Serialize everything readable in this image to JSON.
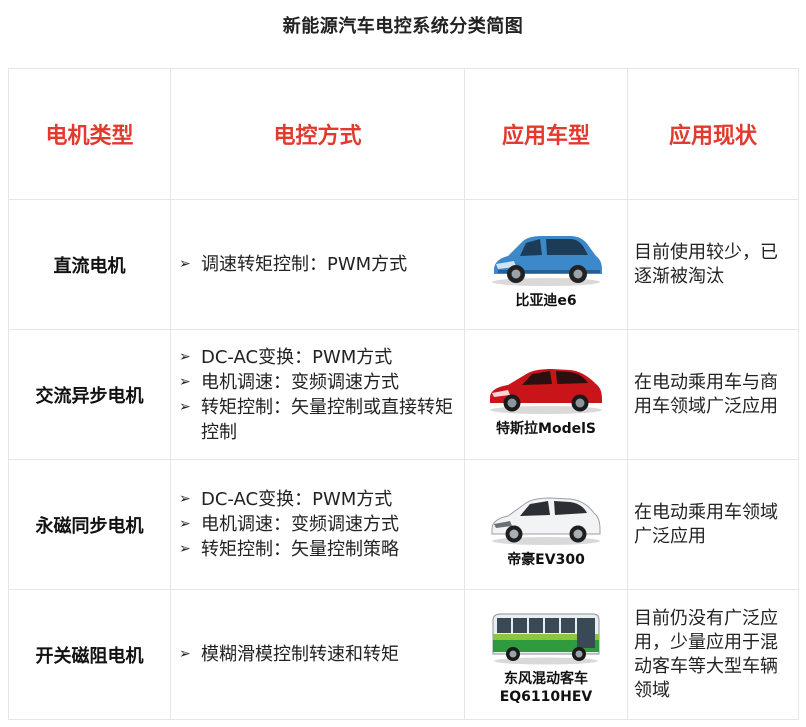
{
  "title": "新能源汽车电控系统分类简图",
  "headers": [
    "电机类型",
    "电控方式",
    "应用车型",
    "应用现状"
  ],
  "colors": {
    "header_red": "#e13a2e"
  },
  "rows": [
    {
      "motor": "直流电机",
      "methods": [
        "调速转矩控制：PWM方式"
      ],
      "vehicle": {
        "name_lines": [
          "比亚迪e6"
        ],
        "image": "blue-hatchback-car"
      },
      "status": "目前使用较少，已逐渐被淘汰"
    },
    {
      "motor": "交流异步电机",
      "methods": [
        "DC-AC变换：PWM方式",
        "电机调速：变频调速方式",
        "转矩控制：矢量控制或直接转矩控制"
      ],
      "vehicle": {
        "name_lines": [
          "特斯拉ModelS"
        ],
        "image": "red-sedan-car"
      },
      "status": "在电动乘用车与商用车领域广泛应用"
    },
    {
      "motor": "永磁同步电机",
      "methods": [
        "DC-AC变换：PWM方式",
        "电机调速：变频调速方式",
        "转矩控制：矢量控制策略"
      ],
      "vehicle": {
        "name_lines": [
          "帝豪EV300"
        ],
        "image": "white-sedan-car"
      },
      "status": "在电动乘用车领域广泛应用"
    },
    {
      "motor": "开关磁阻电机",
      "methods": [
        "模糊滑模控制转速和转矩"
      ],
      "vehicle": {
        "name_lines": [
          "东风混动客车",
          "EQ6110HEV"
        ],
        "image": "green-city-bus"
      },
      "status": "目前仍没有广泛应用，少量应用于混动客车等大型车辆领域"
    }
  ]
}
